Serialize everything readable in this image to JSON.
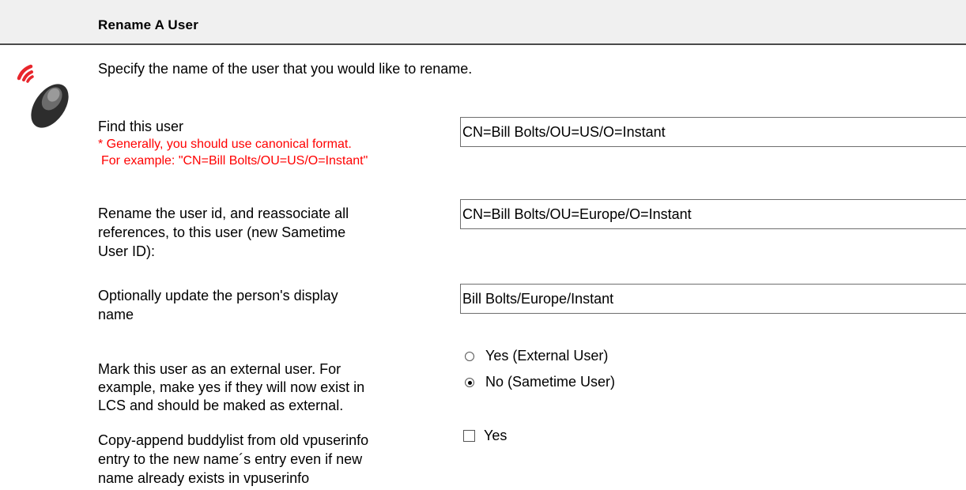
{
  "header": {
    "title": "Rename A User"
  },
  "intro": "Specify the name of the user that you would like to rename.",
  "fields": {
    "find_user": {
      "label": "Find this user",
      "hint_1": "* Generally, you should use canonical format.",
      "hint_2": "For example: \"CN=Bill Bolts/OU=US/O=Instant\"",
      "value": "CN=Bill Bolts/OU=US/O=Instant"
    },
    "rename_id": {
      "label_1": "Rename the user id, and reassociate all",
      "label_2": "references, to this user (new Sametime",
      "label_3": "User ID):",
      "value": "CN=Bill Bolts/OU=Europe/O=Instant"
    },
    "display_name": {
      "label_1": "Optionally update the person's display",
      "label_2": "name",
      "value": "Bill Bolts/Europe/Instant"
    },
    "external_user": {
      "label_1": "Mark this user as an external user.  For",
      "label_2": "example, make yes if they will now exist in",
      "label_3": "LCS and should be maked as external.",
      "options": [
        "Yes (External User)",
        "No (Sametime User)"
      ],
      "selected": "No (Sametime User)"
    },
    "buddylist": {
      "label_1": "Copy-append buddylist from old vpuserinfo",
      "label_2": "entry to the new name´s entry even if new",
      "label_3": "name already exists in vpuserinfo",
      "option": "Yes",
      "checked": false
    }
  },
  "icons": {
    "logo": "remote-control-icon"
  },
  "colors": {
    "hint": "#ff0000",
    "header_bg": "#f0f0f0"
  }
}
